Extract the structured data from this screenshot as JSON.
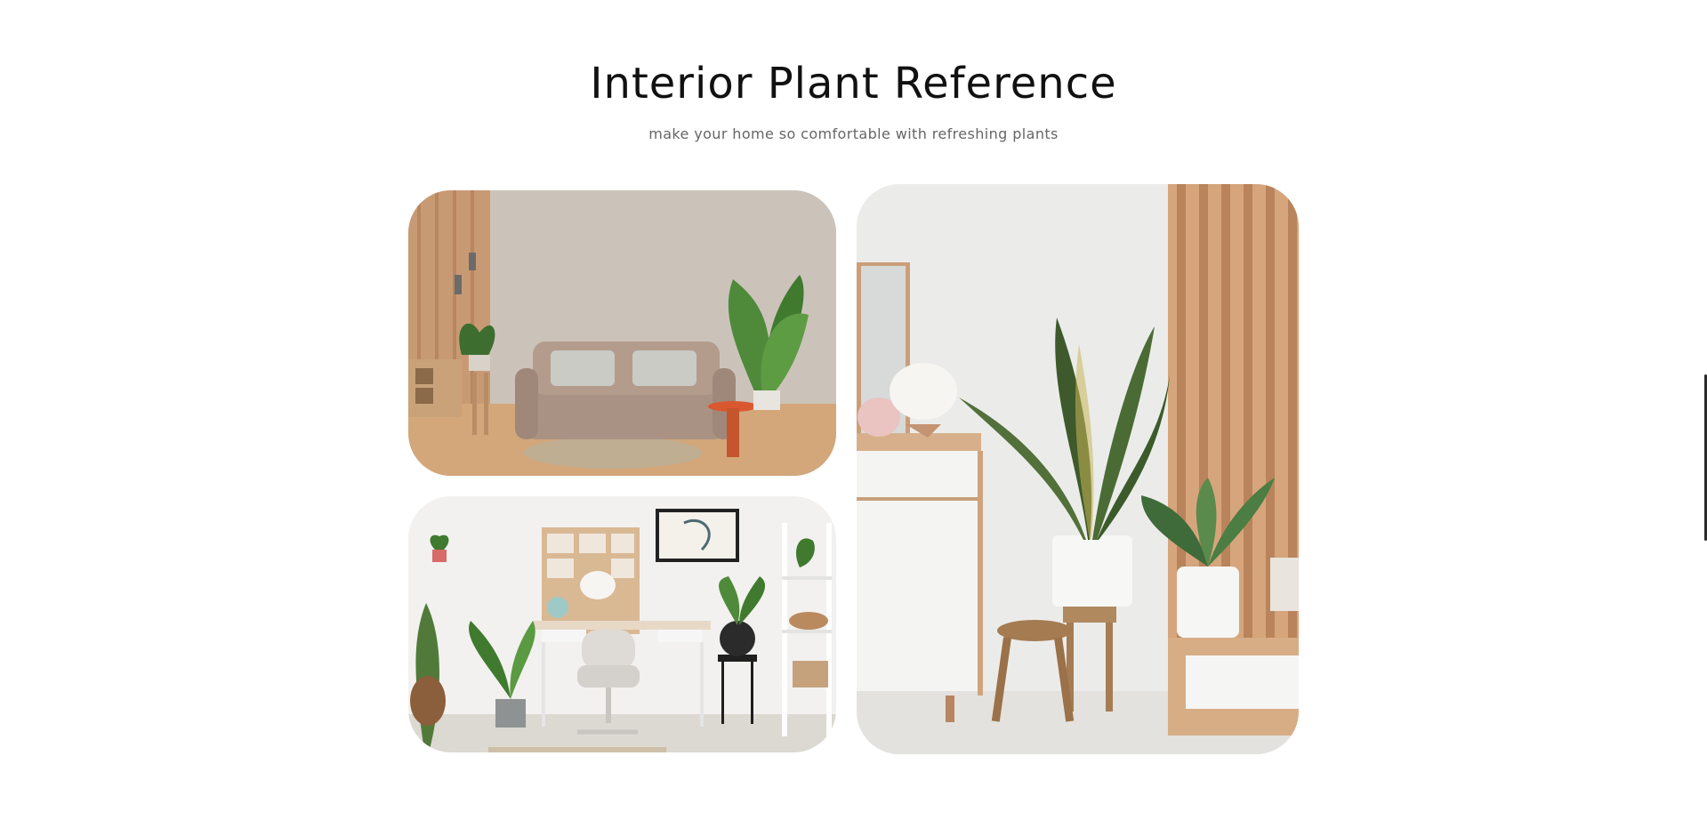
{
  "section": {
    "title": "Interior Plant Reference",
    "subtitle": "make your home so comfortable with refreshing plants"
  },
  "gallery": [
    {
      "key": "living",
      "icon": "living-room-photo"
    },
    {
      "key": "office",
      "icon": "home-office-photo"
    },
    {
      "key": "hall",
      "icon": "snake-plant-corner-photo"
    }
  ],
  "colors": {
    "title": "#111111",
    "subtitle": "#666666",
    "background": "#ffffff",
    "scrollbar": "#2b2b2b"
  }
}
